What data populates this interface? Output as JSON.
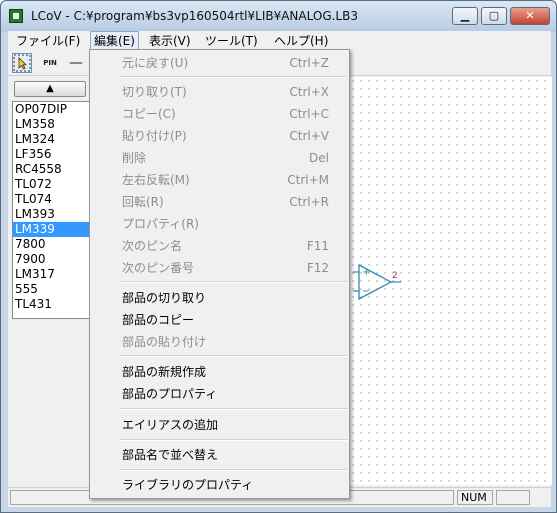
{
  "window": {
    "title": "LCoV - C:¥program¥bs3vp160504rtl¥LIB¥ANALOG.LB3",
    "minimize_label": "▁",
    "maximize_label": "▢",
    "close_label": "✕"
  },
  "menubar": {
    "items": [
      {
        "label": "ファイル(F)"
      },
      {
        "label": "編集(E)"
      },
      {
        "label": "表示(V)"
      },
      {
        "label": "ツール(T)"
      },
      {
        "label": "ヘルプ(H)"
      }
    ]
  },
  "toolbar": {
    "select_tool_icon": "cursor-select-icon",
    "pin_tool_label": "PIN",
    "line_tool_label": "—"
  },
  "parts": {
    "up_button_icon": "up-arrow-icon",
    "up_button_glyph": "▲",
    "items": [
      "OP07DIP",
      "LM358",
      "LM324",
      "LF356",
      "RC4558",
      "TL072",
      "TL074",
      "LM393",
      "LM339",
      "7800",
      "7900",
      "LM317",
      "555",
      "TL431"
    ],
    "selected": "LM339"
  },
  "canvas": {
    "opamp": {
      "plus_label": "+",
      "minus_label": "−",
      "pin_number": "2"
    }
  },
  "status": {
    "num_label": "NUM"
  },
  "edit_menu": {
    "items": [
      {
        "label": "元に戻す(U)",
        "shortcut": "Ctrl+Z",
        "enabled": false
      },
      {
        "label": "切り取り(T)",
        "shortcut": "Ctrl+X",
        "enabled": false
      },
      {
        "label": "コピー(C)",
        "shortcut": "Ctrl+C",
        "enabled": false
      },
      {
        "label": "貼り付け(P)",
        "shortcut": "Ctrl+V",
        "enabled": false
      },
      {
        "label": "削除",
        "shortcut": "Del",
        "enabled": false
      },
      {
        "label": "左右反転(M)",
        "shortcut": "Ctrl+M",
        "enabled": false
      },
      {
        "label": "回転(R)",
        "shortcut": "Ctrl+R",
        "enabled": false
      },
      {
        "label": "プロパティ(R)",
        "shortcut": "",
        "enabled": false
      },
      {
        "label": "次のピン名",
        "shortcut": "F11",
        "enabled": false
      },
      {
        "label": "次のピン番号",
        "shortcut": "F12",
        "enabled": false
      },
      {
        "label": "部品の切り取り",
        "shortcut": "",
        "enabled": true
      },
      {
        "label": "部品のコピー",
        "shortcut": "",
        "enabled": true
      },
      {
        "label": "部品の貼り付け",
        "shortcut": "",
        "enabled": false
      },
      {
        "label": "部品の新規作成",
        "shortcut": "",
        "enabled": true
      },
      {
        "label": "部品のプロパティ",
        "shortcut": "",
        "enabled": true
      },
      {
        "label": "エイリアスの追加",
        "shortcut": "",
        "enabled": true
      },
      {
        "label": "部品名で並べ替え",
        "shortcut": "",
        "enabled": true
      },
      {
        "label": "ライブラリのプロパティ",
        "shortcut": "",
        "enabled": true
      }
    ]
  },
  "colors": {
    "selection": "#3399ff",
    "opamp_stroke": "#2a8ab0",
    "pin_number": "#b0307a",
    "disabled_text": "#8d8d8d"
  }
}
